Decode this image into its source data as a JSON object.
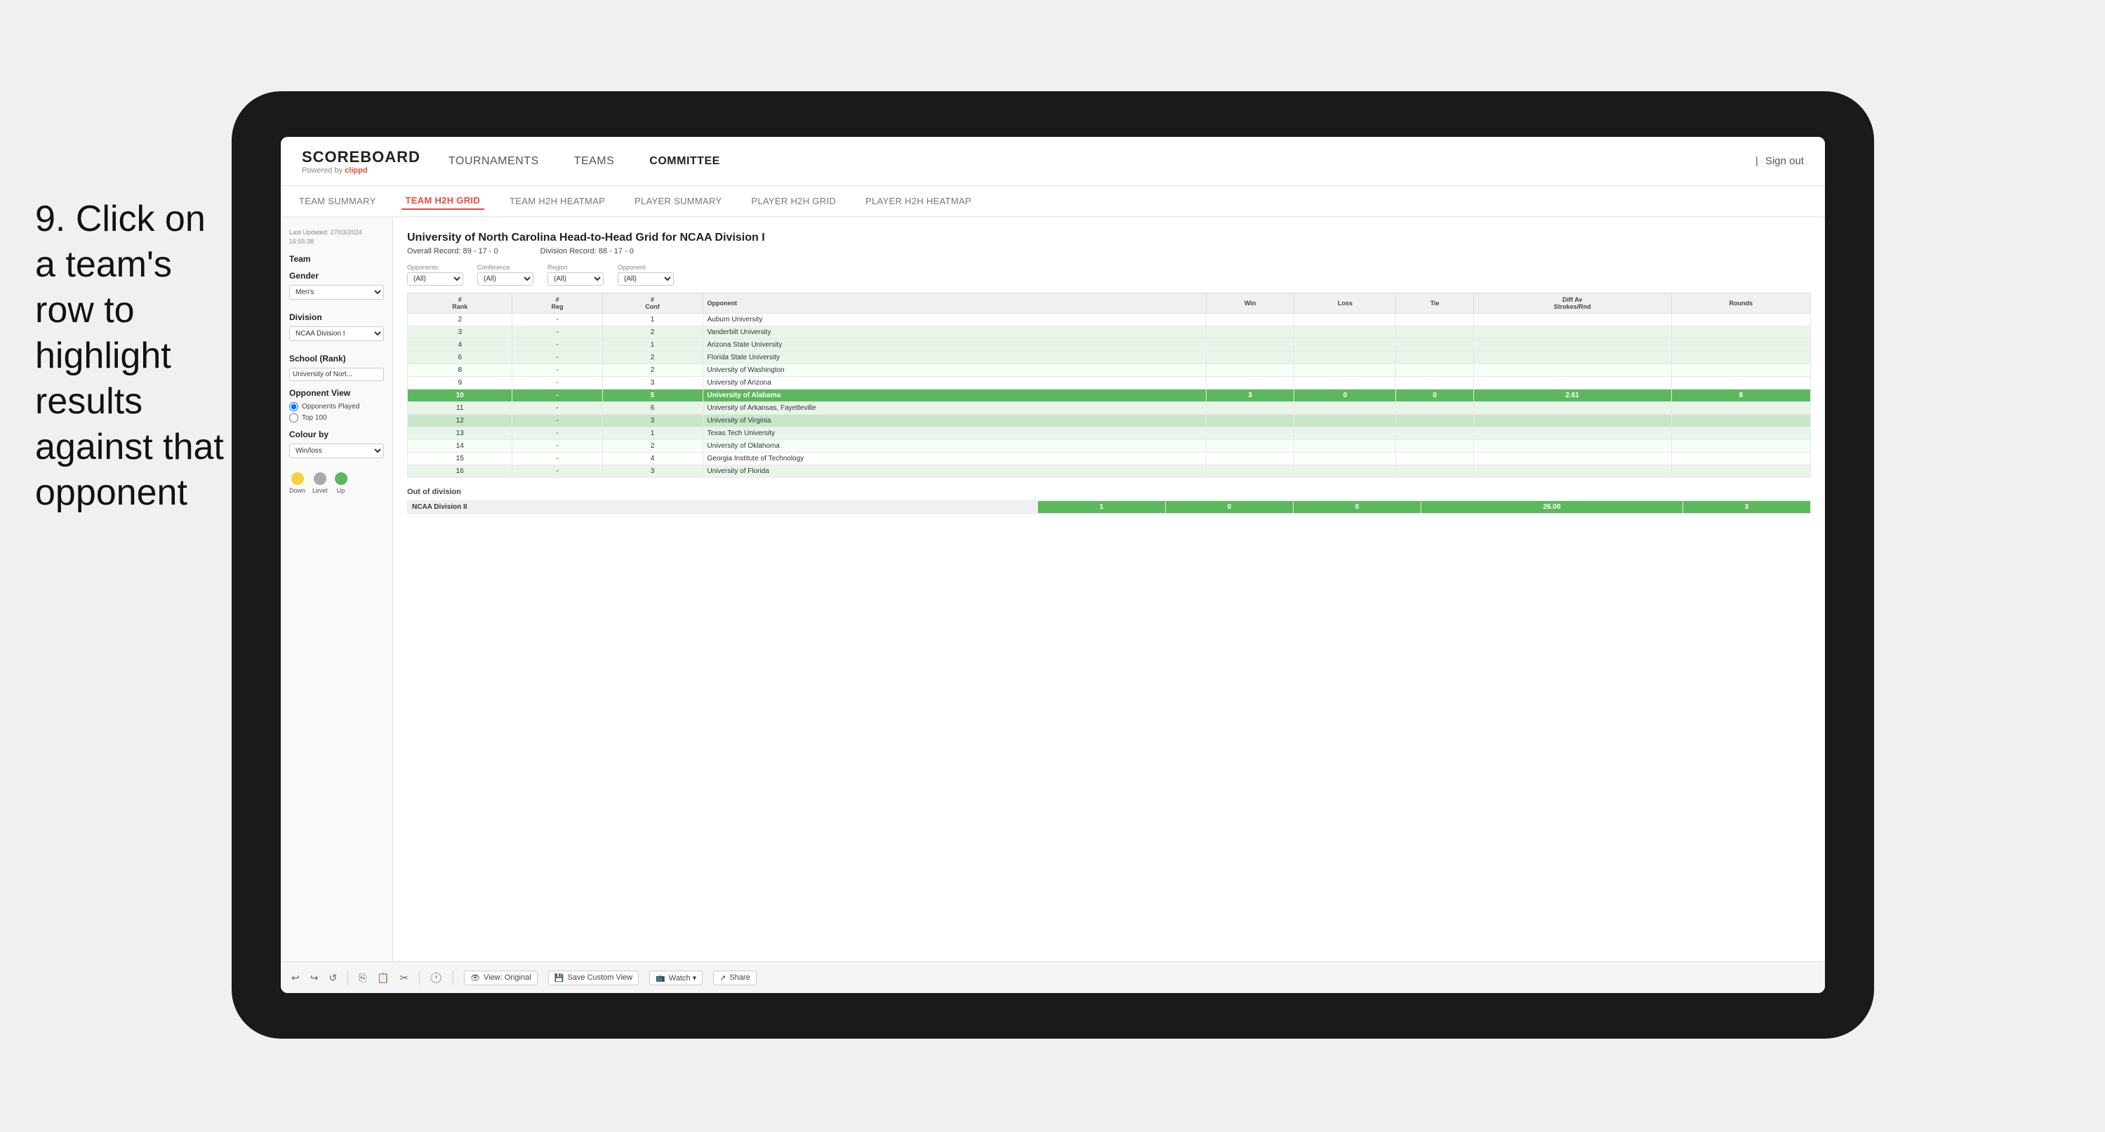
{
  "instruction": {
    "step": "9.",
    "text": "Click on a team's row to highlight results against that opponent"
  },
  "nav": {
    "logo": "SCOREBOARD",
    "powered_by": "Powered by",
    "brand": "clippd",
    "links": [
      "TOURNAMENTS",
      "TEAMS",
      "COMMITTEE"
    ],
    "active_link": "COMMITTEE",
    "sign_out": "Sign out"
  },
  "sub_nav": {
    "links": [
      "TEAM SUMMARY",
      "TEAM H2H GRID",
      "TEAM H2H HEATMAP",
      "PLAYER SUMMARY",
      "PLAYER H2H GRID",
      "PLAYER H2H HEATMAP"
    ],
    "active": "TEAM H2H GRID"
  },
  "sidebar": {
    "last_updated_label": "Last Updated: 27/03/2024",
    "last_updated_time": "16:55:38",
    "team_label": "Team",
    "gender_label": "Gender",
    "gender_value": "Men's",
    "division_label": "Division",
    "division_value": "NCAA Division I",
    "school_label": "School (Rank)",
    "school_value": "University of Nort...",
    "opponent_view_label": "Opponent View",
    "radio_opponents": "Opponents Played",
    "radio_top100": "Top 100",
    "colour_by_label": "Colour by",
    "colour_by_value": "Win/loss",
    "legend": [
      {
        "label": "Down",
        "color": "#f4d03f"
      },
      {
        "label": "Level",
        "color": "#aaa"
      },
      {
        "label": "Up",
        "color": "#5cb85c"
      }
    ]
  },
  "grid": {
    "title": "University of North Carolina Head-to-Head Grid for NCAA Division I",
    "overall_record_label": "Overall Record:",
    "overall_record": "89 - 17 - 0",
    "division_record_label": "Division Record:",
    "division_record": "88 - 17 - 0",
    "filters": {
      "opponents_label": "Opponents:",
      "opponents_value": "(All)",
      "conference_label": "Conference",
      "conference_value": "(All)",
      "region_label": "Region",
      "region_value": "(All)",
      "opponent_label": "Opponent",
      "opponent_value": "(All)"
    },
    "columns": [
      "#\nRank",
      "#\nReg",
      "#\nConf",
      "Opponent",
      "Win",
      "Loss",
      "Tie",
      "Diff Av\nStrokes/Rnd",
      "Rounds"
    ],
    "rows": [
      {
        "rank": "2",
        "reg": "-",
        "conf": "1",
        "opponent": "Auburn University",
        "win": "",
        "loss": "",
        "tie": "",
        "diff": "",
        "rounds": "",
        "style": "normal"
      },
      {
        "rank": "3",
        "reg": "-",
        "conf": "2",
        "opponent": "Vanderbilt University",
        "win": "",
        "loss": "",
        "tie": "",
        "diff": "",
        "rounds": "",
        "style": "light-green"
      },
      {
        "rank": "4",
        "reg": "-",
        "conf": "1",
        "opponent": "Arizona State University",
        "win": "",
        "loss": "",
        "tie": "",
        "diff": "",
        "rounds": "",
        "style": "light-green"
      },
      {
        "rank": "6",
        "reg": "-",
        "conf": "2",
        "opponent": "Florida State University",
        "win": "",
        "loss": "",
        "tie": "",
        "diff": "",
        "rounds": "",
        "style": "light-green"
      },
      {
        "rank": "8",
        "reg": "-",
        "conf": "2",
        "opponent": "University of Washington",
        "win": "",
        "loss": "",
        "tie": "",
        "diff": "",
        "rounds": "",
        "style": "very-light"
      },
      {
        "rank": "9",
        "reg": "-",
        "conf": "3",
        "opponent": "University of Arizona",
        "win": "",
        "loss": "",
        "tie": "",
        "diff": "",
        "rounds": "",
        "style": "normal"
      },
      {
        "rank": "10",
        "reg": "-",
        "conf": "5",
        "opponent": "University of Alabama",
        "win": "3",
        "loss": "0",
        "tie": "0",
        "diff": "2.61",
        "rounds": "8",
        "style": "highlighted"
      },
      {
        "rank": "11",
        "reg": "-",
        "conf": "6",
        "opponent": "University of Arkansas, Fayetteville",
        "win": "",
        "loss": "",
        "tie": "",
        "diff": "",
        "rounds": "",
        "style": "light-green"
      },
      {
        "rank": "12",
        "reg": "-",
        "conf": "3",
        "opponent": "University of Virginia",
        "win": "",
        "loss": "",
        "tie": "",
        "diff": "",
        "rounds": "",
        "style": "medium-green"
      },
      {
        "rank": "13",
        "reg": "-",
        "conf": "1",
        "opponent": "Texas Tech University",
        "win": "",
        "loss": "",
        "tie": "",
        "diff": "",
        "rounds": "",
        "style": "light-green"
      },
      {
        "rank": "14",
        "reg": "-",
        "conf": "2",
        "opponent": "University of Oklahoma",
        "win": "",
        "loss": "",
        "tie": "",
        "diff": "",
        "rounds": "",
        "style": "very-light"
      },
      {
        "rank": "15",
        "reg": "-",
        "conf": "4",
        "opponent": "Georgia Institute of Technology",
        "win": "",
        "loss": "",
        "tie": "",
        "diff": "",
        "rounds": "",
        "style": "normal"
      },
      {
        "rank": "16",
        "reg": "-",
        "conf": "3",
        "opponent": "University of Florida",
        "win": "",
        "loss": "",
        "tie": "",
        "diff": "",
        "rounds": "",
        "style": "light-green"
      }
    ],
    "out_of_division_label": "Out of division",
    "out_div_rows": [
      {
        "label": "NCAA Division II",
        "win": "1",
        "loss": "0",
        "tie": "0",
        "diff": "26.00",
        "rounds": "3",
        "style": "green"
      }
    ]
  },
  "toolbar": {
    "buttons": [
      "View: Original",
      "Save Custom View",
      "Watch ▾",
      "Share"
    ]
  }
}
